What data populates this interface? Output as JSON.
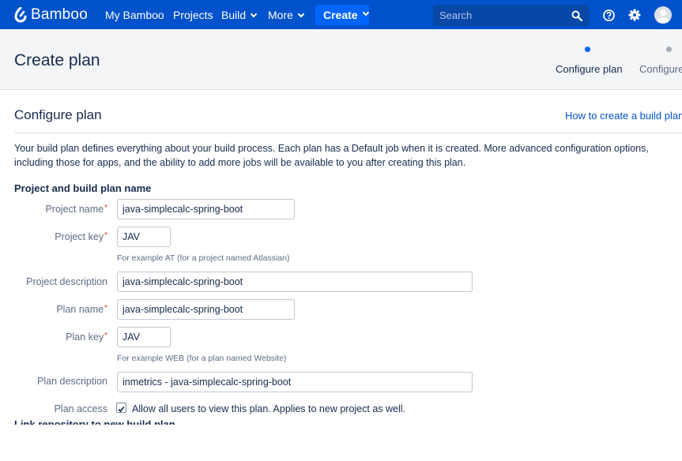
{
  "nav": {
    "logo": "Bamboo",
    "links": [
      "My Bamboo",
      "Projects",
      "Build",
      "More"
    ],
    "create": "Create",
    "search_placeholder": "Search",
    "icons": [
      "bamboo-logo-icon",
      "chevron-down-icon",
      "search-icon",
      "help-icon",
      "gear-icon",
      "avatar"
    ]
  },
  "header": {
    "title": "Create plan",
    "steps": [
      "Configure plan",
      "Configure"
    ],
    "active_step": 0
  },
  "section": {
    "title": "Configure plan",
    "help_link": "How to create a build plan",
    "intro": "Your build plan defines everything about your build process. Each plan has a Default job when it is created. More advanced configuration options, including those for apps, and the ability to add more jobs will be available to you after creating this plan.",
    "subheading": "Project and build plan name"
  },
  "form": {
    "project_name": {
      "label": "Project name",
      "value": "java-simplecalc-spring-boot"
    },
    "project_key": {
      "label": "Project key",
      "value": "JAV",
      "hint": "For example AT (for a project named Atlassian)"
    },
    "project_description": {
      "label": "Project description",
      "value": "java-simplecalc-spring-boot"
    },
    "plan_name": {
      "label": "Plan name",
      "value": "java-simplecalc-spring-boot"
    },
    "plan_key": {
      "label": "Plan key",
      "value": "JAV",
      "hint": "For example WEB (for a plan named Website)"
    },
    "plan_description": {
      "label": "Plan description",
      "value": "inmetrics - java-simplecalc-spring-boot"
    },
    "plan_access": {
      "label": "Plan access",
      "checkbox_label": "Allow all users to view this plan. Applies to new project as well.",
      "checked": true
    },
    "required_mark": "*",
    "cutoff_heading": "Link repository to new build plan"
  },
  "colors": {
    "nav_bg": "#0052cc",
    "create_btn": "#0065ff",
    "search_bg": "#0747a6",
    "link": "#0052cc",
    "required": "#de350b",
    "header_bg": "#f4f5f7"
  }
}
